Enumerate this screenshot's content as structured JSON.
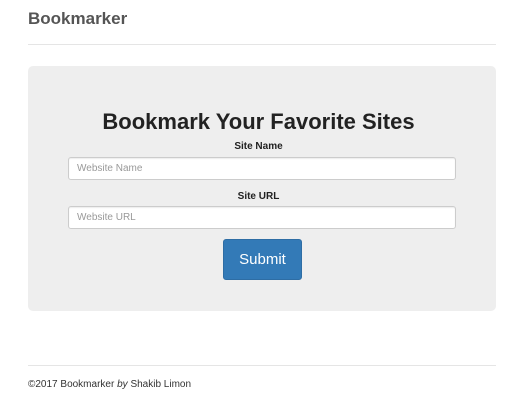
{
  "header": {
    "brand": "Bookmarker"
  },
  "form": {
    "title": "Bookmark Your Favorite Sites",
    "site_name_label": "Site Name",
    "site_name_placeholder": "Website Name",
    "site_name_value": "",
    "site_url_label": "Site URL",
    "site_url_placeholder": "Website URL",
    "site_url_value": "",
    "submit_label": "Submit"
  },
  "footer": {
    "copyright": "©2017 Bookmarker",
    "by": "by",
    "author": "Shakib Limon"
  },
  "colors": {
    "primary_button": "#337ab7",
    "panel_background": "#eeeeee"
  }
}
